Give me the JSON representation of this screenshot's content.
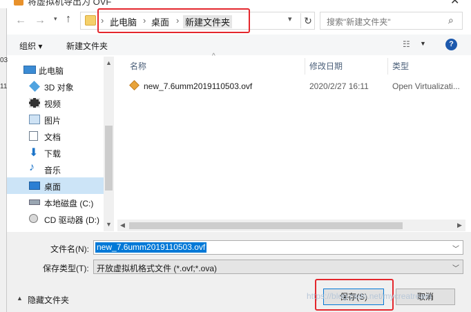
{
  "window": {
    "title": "将虚拟机导出为 OVF"
  },
  "behind_window": {
    "text_a": "03",
    "text_b": "11"
  },
  "address_bar": {
    "crumbs": [
      "此电脑",
      "桌面",
      "新建文件夹"
    ]
  },
  "search": {
    "placeholder": "搜索\"新建文件夹\""
  },
  "toolbar": {
    "organize_label": "组织 ▾",
    "new_folder_label": "新建文件夹",
    "help_label": "?"
  },
  "nav_pane": {
    "items": [
      {
        "label": "此电脑",
        "icon": "computer-icon"
      },
      {
        "label": "3D 对象",
        "icon": "cube-icon"
      },
      {
        "label": "视频",
        "icon": "video-icon"
      },
      {
        "label": "图片",
        "icon": "picture-icon"
      },
      {
        "label": "文档",
        "icon": "document-icon"
      },
      {
        "label": "下载",
        "icon": "download-icon"
      },
      {
        "label": "音乐",
        "icon": "music-icon"
      },
      {
        "label": "桌面",
        "icon": "desktop-icon",
        "selected": true
      },
      {
        "label": "本地磁盘 (C:)",
        "icon": "drive-icon"
      },
      {
        "label": "CD 驱动器 (D:)",
        "icon": "cd-drive-icon"
      }
    ]
  },
  "file_list": {
    "columns": [
      "名称",
      "修改日期",
      "类型"
    ],
    "rows": [
      {
        "name": "new_7.6umm2019110503.ovf",
        "modified": "2020/2/27 16:11",
        "type": "Open Virtualizati..."
      }
    ]
  },
  "form": {
    "filename_label": "文件名(N):",
    "filename_value": "new_7.6umm2019110503.ovf",
    "filetype_label": "保存类型(T):",
    "filetype_value": "开放虚拟机格式文件 (*.ovf;*.ova)"
  },
  "footer": {
    "hide_folders_label": "隐藏文件夹",
    "save_label": "保存(S)",
    "cancel_label": "取消",
    "watermark": "https://blog.csdn.net/mycreatream"
  },
  "colors": {
    "accent": "#0078d7",
    "highlight_box": "#e4262c",
    "selected_nav": "#cce4f7"
  }
}
